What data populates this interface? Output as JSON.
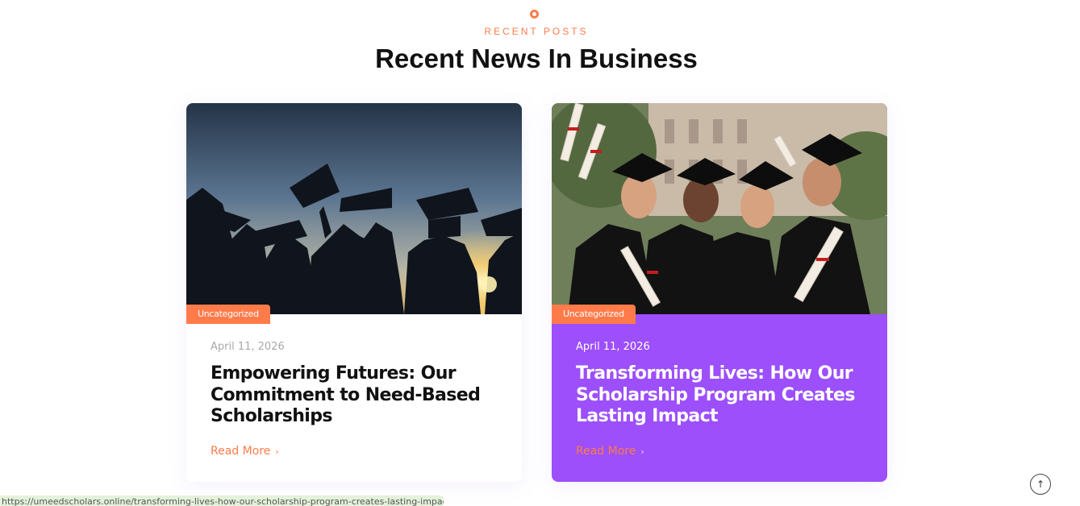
{
  "section": {
    "eyebrow": "RECENT POSTS",
    "heading": "Recent News In Business"
  },
  "posts": [
    {
      "category": "Uncategorized",
      "date": "April 11, 2026",
      "title": "Empowering Futures: Our Commitment to Need-Based Scholarships",
      "read_more": "Read More",
      "image_icon": "graduates-silhouette-photo"
    },
    {
      "category": "Uncategorized",
      "date": "April 11, 2026",
      "title": "Transforming Lives: How Our Scholarship Program Creates Lasting Impact",
      "read_more": "Read More",
      "image_icon": "celebrating-graduates-photo"
    }
  ],
  "status_bar": {
    "url": "https://umeedscholars.online/transforming-lives-how-our-scholarship-program-creates-lasting-impact/"
  },
  "scroll_top_icon": "arrow-up-icon",
  "colors": {
    "accent": "#ff7b4a",
    "highlight_card": "#9c4ffb",
    "heading": "#111111"
  }
}
